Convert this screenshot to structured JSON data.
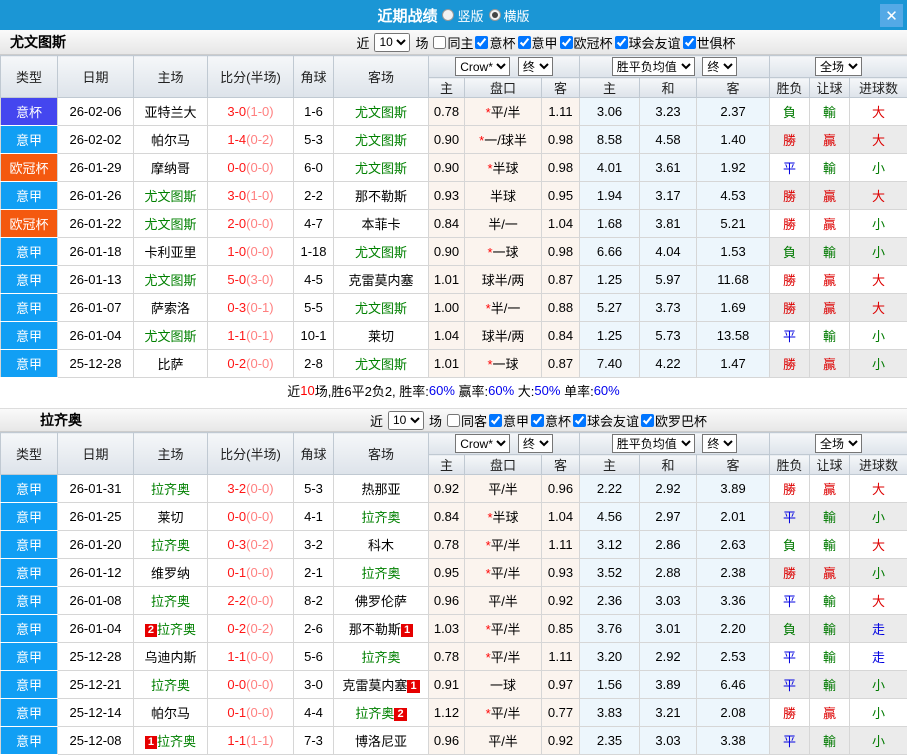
{
  "titlebar": {
    "title": "近期战绩",
    "radios": [
      {
        "label": "竖版",
        "selected": false
      },
      {
        "label": "横版",
        "selected": true
      }
    ],
    "close_label": "✕"
  },
  "league_colors": {
    "意甲": "#119ff4",
    "意杯": "#4446ef",
    "欧冠杯": "#f4590f"
  },
  "table_headers": {
    "type": "类型",
    "date": "日期",
    "home": "主场",
    "score": "比分(半场)",
    "corner": "角球",
    "away": "客场",
    "odds_home": "主",
    "handicap": "盘口",
    "odds_away": "客",
    "avg_home": "主",
    "avg_draw": "和",
    "avg_away": "客",
    "result_wdl": "胜负",
    "result_handicap": "让球",
    "result_goals": "进球数",
    "dd_crow": "Crow*",
    "dd_final1": "终",
    "dd_avg": "胜平负均值",
    "dd_final2": "终",
    "dd_fulltime": "全场"
  },
  "sections": [
    {
      "team": "尤文图斯",
      "filter": {
        "jin": "近",
        "count": "10",
        "chang": "场",
        "checkboxes": [
          {
            "label": "同主",
            "checked": false
          },
          {
            "label": "意杯",
            "checked": true
          },
          {
            "label": "意甲",
            "checked": true
          },
          {
            "label": "欧冠杯",
            "checked": true
          },
          {
            "label": "球会友谊",
            "checked": true
          },
          {
            "label": "世俱杯",
            "checked": true
          }
        ]
      },
      "rows": [
        {
          "lg": "意杯",
          "date": "26-02-06",
          "home": "亚特兰大",
          "hg": false,
          "hb": "",
          "score": "3-0",
          "half": "(1-0)",
          "cn": "1-6",
          "away": "尤文图斯",
          "ag": true,
          "ab": "",
          "o": [
            "0.78",
            "平/半",
            "1.11"
          ],
          "star": true,
          "avg": [
            "3.06",
            "3.23",
            "2.37"
          ],
          "res": [
            [
              "負",
              "g"
            ],
            [
              "輸",
              "g"
            ],
            [
              "大",
              "r"
            ]
          ]
        },
        {
          "lg": "意甲",
          "date": "26-02-02",
          "home": "帕尔马",
          "hg": false,
          "hb": "",
          "score": "1-4",
          "half": "(0-2)",
          "cn": "5-3",
          "away": "尤文图斯",
          "ag": true,
          "ab": "",
          "o": [
            "0.90",
            "一/球半",
            "0.98"
          ],
          "star": true,
          "avg": [
            "8.58",
            "4.58",
            "1.40"
          ],
          "res": [
            [
              "勝",
              "r"
            ],
            [
              "贏",
              "r"
            ],
            [
              "大",
              "r"
            ]
          ]
        },
        {
          "lg": "欧冠杯",
          "date": "26-01-29",
          "home": "摩纳哥",
          "hg": false,
          "hb": "",
          "score": "0-0",
          "half": "(0-0)",
          "cn": "6-0",
          "away": "尤文图斯",
          "ag": true,
          "ab": "",
          "o": [
            "0.90",
            "半球",
            "0.98"
          ],
          "star": true,
          "avg": [
            "4.01",
            "3.61",
            "1.92"
          ],
          "res": [
            [
              "平",
              "b"
            ],
            [
              "輸",
              "g"
            ],
            [
              "小",
              "g"
            ]
          ]
        },
        {
          "lg": "意甲",
          "date": "26-01-26",
          "home": "尤文图斯",
          "hg": true,
          "hb": "",
          "score": "3-0",
          "half": "(1-0)",
          "cn": "2-2",
          "away": "那不勒斯",
          "ag": false,
          "ab": "",
          "o": [
            "0.93",
            "半球",
            "0.95"
          ],
          "star": false,
          "avg": [
            "1.94",
            "3.17",
            "4.53"
          ],
          "res": [
            [
              "勝",
              "r"
            ],
            [
              "贏",
              "r"
            ],
            [
              "大",
              "r"
            ]
          ]
        },
        {
          "lg": "欧冠杯",
          "date": "26-01-22",
          "home": "尤文图斯",
          "hg": true,
          "hb": "",
          "score": "2-0",
          "half": "(0-0)",
          "cn": "4-7",
          "away": "本菲卡",
          "ag": false,
          "ab": "",
          "o": [
            "0.84",
            "半/一",
            "1.04"
          ],
          "star": false,
          "avg": [
            "1.68",
            "3.81",
            "5.21"
          ],
          "res": [
            [
              "勝",
              "r"
            ],
            [
              "贏",
              "r"
            ],
            [
              "小",
              "g"
            ]
          ]
        },
        {
          "lg": "意甲",
          "date": "26-01-18",
          "home": "卡利亚里",
          "hg": false,
          "hb": "",
          "score": "1-0",
          "half": "(0-0)",
          "cn": "1-18",
          "away": "尤文图斯",
          "ag": true,
          "ab": "",
          "o": [
            "0.90",
            "一球",
            "0.98"
          ],
          "star": true,
          "avg": [
            "6.66",
            "4.04",
            "1.53"
          ],
          "res": [
            [
              "負",
              "g"
            ],
            [
              "輸",
              "g"
            ],
            [
              "小",
              "g"
            ]
          ]
        },
        {
          "lg": "意甲",
          "date": "26-01-13",
          "home": "尤文图斯",
          "hg": true,
          "hb": "",
          "score": "5-0",
          "half": "(3-0)",
          "cn": "4-5",
          "away": "克雷莫内塞",
          "ag": false,
          "ab": "",
          "o": [
            "1.01",
            "球半/两",
            "0.87"
          ],
          "star": false,
          "avg": [
            "1.25",
            "5.97",
            "11.68"
          ],
          "res": [
            [
              "勝",
              "r"
            ],
            [
              "贏",
              "r"
            ],
            [
              "大",
              "r"
            ]
          ]
        },
        {
          "lg": "意甲",
          "date": "26-01-07",
          "home": "萨索洛",
          "hg": false,
          "hb": "",
          "score": "0-3",
          "half": "(0-1)",
          "cn": "5-5",
          "away": "尤文图斯",
          "ag": true,
          "ab": "",
          "o": [
            "1.00",
            "半/一",
            "0.88"
          ],
          "star": true,
          "avg": [
            "5.27",
            "3.73",
            "1.69"
          ],
          "res": [
            [
              "勝",
              "r"
            ],
            [
              "贏",
              "r"
            ],
            [
              "大",
              "r"
            ]
          ]
        },
        {
          "lg": "意甲",
          "date": "26-01-04",
          "home": "尤文图斯",
          "hg": true,
          "hb": "",
          "score": "1-1",
          "half": "(0-1)",
          "cn": "10-1",
          "away": "莱切",
          "ag": false,
          "ab": "",
          "o": [
            "1.04",
            "球半/两",
            "0.84"
          ],
          "star": false,
          "avg": [
            "1.25",
            "5.73",
            "13.58"
          ],
          "res": [
            [
              "平",
              "b"
            ],
            [
              "輸",
              "g"
            ],
            [
              "小",
              "g"
            ]
          ]
        },
        {
          "lg": "意甲",
          "date": "25-12-28",
          "home": "比萨",
          "hg": false,
          "hb": "",
          "score": "0-2",
          "half": "(0-0)",
          "cn": "2-8",
          "away": "尤文图斯",
          "ag": true,
          "ab": "",
          "o": [
            "1.01",
            "一球",
            "0.87"
          ],
          "star": true,
          "avg": [
            "7.40",
            "4.22",
            "1.47"
          ],
          "res": [
            [
              "勝",
              "r"
            ],
            [
              "贏",
              "r"
            ],
            [
              "小",
              "g"
            ]
          ]
        }
      ],
      "summary_parts": [
        [
          "近",
          "k"
        ],
        [
          "10",
          "r"
        ],
        [
          "场,胜6平2负2, 胜率:",
          "k"
        ],
        [
          "60%",
          "b"
        ],
        [
          " 赢率:",
          "k"
        ],
        [
          "60%",
          "b"
        ],
        [
          " 大:",
          "k"
        ],
        [
          "50%",
          "b"
        ],
        [
          " 单率:",
          "k"
        ],
        [
          "60%",
          "b"
        ]
      ]
    },
    {
      "team": "拉齐奥",
      "filter": {
        "jin": "近",
        "count": "10",
        "chang": "场",
        "checkboxes": [
          {
            "label": "同客",
            "checked": false
          },
          {
            "label": "意甲",
            "checked": true
          },
          {
            "label": "意杯",
            "checked": true
          },
          {
            "label": "球会友谊",
            "checked": true
          },
          {
            "label": "欧罗巴杯",
            "checked": true
          }
        ]
      },
      "rows": [
        {
          "lg": "意甲",
          "date": "26-01-31",
          "home": "拉齐奥",
          "hg": true,
          "hb": "",
          "score": "3-2",
          "half": "(0-0)",
          "cn": "5-3",
          "away": "热那亚",
          "ag": false,
          "ab": "",
          "o": [
            "0.92",
            "平/半",
            "0.96"
          ],
          "star": false,
          "avg": [
            "2.22",
            "2.92",
            "3.89"
          ],
          "res": [
            [
              "勝",
              "r"
            ],
            [
              "贏",
              "r"
            ],
            [
              "大",
              "r"
            ]
          ]
        },
        {
          "lg": "意甲",
          "date": "26-01-25",
          "home": "莱切",
          "hg": false,
          "hb": "",
          "score": "0-0",
          "half": "(0-0)",
          "cn": "4-1",
          "away": "拉齐奥",
          "ag": true,
          "ab": "",
          "o": [
            "0.84",
            "半球",
            "1.04"
          ],
          "star": true,
          "avg": [
            "4.56",
            "2.97",
            "2.01"
          ],
          "res": [
            [
              "平",
              "b"
            ],
            [
              "輸",
              "g"
            ],
            [
              "小",
              "g"
            ]
          ]
        },
        {
          "lg": "意甲",
          "date": "26-01-20",
          "home": "拉齐奥",
          "hg": true,
          "hb": "",
          "score": "0-3",
          "half": "(0-2)",
          "cn": "3-2",
          "away": "科木",
          "ag": false,
          "ab": "",
          "o": [
            "0.78",
            "平/半",
            "1.11"
          ],
          "star": true,
          "avg": [
            "3.12",
            "2.86",
            "2.63"
          ],
          "res": [
            [
              "負",
              "g"
            ],
            [
              "輸",
              "g"
            ],
            [
              "大",
              "r"
            ]
          ]
        },
        {
          "lg": "意甲",
          "date": "26-01-12",
          "home": "维罗纳",
          "hg": false,
          "hb": "",
          "score": "0-1",
          "half": "(0-0)",
          "cn": "2-1",
          "away": "拉齐奥",
          "ag": true,
          "ab": "",
          "o": [
            "0.95",
            "平/半",
            "0.93"
          ],
          "star": true,
          "avg": [
            "3.52",
            "2.88",
            "2.38"
          ],
          "res": [
            [
              "勝",
              "r"
            ],
            [
              "贏",
              "r"
            ],
            [
              "小",
              "g"
            ]
          ]
        },
        {
          "lg": "意甲",
          "date": "26-01-08",
          "home": "拉齐奥",
          "hg": true,
          "hb": "",
          "score": "2-2",
          "half": "(0-0)",
          "cn": "8-2",
          "away": "佛罗伦萨",
          "ag": false,
          "ab": "",
          "o": [
            "0.96",
            "平/半",
            "0.92"
          ],
          "star": false,
          "avg": [
            "2.36",
            "3.03",
            "3.36"
          ],
          "res": [
            [
              "平",
              "b"
            ],
            [
              "輸",
              "g"
            ],
            [
              "大",
              "r"
            ]
          ]
        },
        {
          "lg": "意甲",
          "date": "26-01-04",
          "home": "拉齐奥",
          "hg": true,
          "hb": "2",
          "score": "0-2",
          "half": "(0-2)",
          "cn": "2-6",
          "away": "那不勒斯",
          "ag": false,
          "ab": "1",
          "o": [
            "1.03",
            "平/半",
            "0.85"
          ],
          "star": true,
          "avg": [
            "3.76",
            "3.01",
            "2.20"
          ],
          "res": [
            [
              "負",
              "g"
            ],
            [
              "輸",
              "g"
            ],
            [
              "走",
              "b"
            ]
          ]
        },
        {
          "lg": "意甲",
          "date": "25-12-28",
          "home": "乌迪内斯",
          "hg": false,
          "hb": "",
          "score": "1-1",
          "half": "(0-0)",
          "cn": "5-6",
          "away": "拉齐奥",
          "ag": true,
          "ab": "",
          "o": [
            "0.78",
            "平/半",
            "1.11"
          ],
          "star": true,
          "avg": [
            "3.20",
            "2.92",
            "2.53"
          ],
          "res": [
            [
              "平",
              "b"
            ],
            [
              "輸",
              "g"
            ],
            [
              "走",
              "b"
            ]
          ]
        },
        {
          "lg": "意甲",
          "date": "25-12-21",
          "home": "拉齐奥",
          "hg": true,
          "hb": "",
          "score": "0-0",
          "half": "(0-0)",
          "cn": "3-0",
          "away": "克雷莫内塞",
          "ag": false,
          "ab": "1",
          "o": [
            "0.91",
            "一球",
            "0.97"
          ],
          "star": false,
          "avg": [
            "1.56",
            "3.89",
            "6.46"
          ],
          "res": [
            [
              "平",
              "b"
            ],
            [
              "輸",
              "g"
            ],
            [
              "小",
              "g"
            ]
          ]
        },
        {
          "lg": "意甲",
          "date": "25-12-14",
          "home": "帕尔马",
          "hg": false,
          "hb": "",
          "score": "0-1",
          "half": "(0-0)",
          "cn": "4-4",
          "away": "拉齐奥",
          "ag": true,
          "ab": "2",
          "o": [
            "1.12",
            "平/半",
            "0.77"
          ],
          "star": true,
          "avg": [
            "3.83",
            "3.21",
            "2.08"
          ],
          "res": [
            [
              "勝",
              "r"
            ],
            [
              "贏",
              "r"
            ],
            [
              "小",
              "g"
            ]
          ]
        },
        {
          "lg": "意甲",
          "date": "25-12-08",
          "home": "拉齐奥",
          "hg": true,
          "hb": "1",
          "score": "1-1",
          "half": "(1-1)",
          "cn": "7-3",
          "away": "博洛尼亚",
          "ag": false,
          "ab": "",
          "o": [
            "0.96",
            "平/半",
            "0.92"
          ],
          "star": false,
          "avg": [
            "2.35",
            "3.03",
            "3.38"
          ],
          "res": [
            [
              "平",
              "b"
            ],
            [
              "輸",
              "g"
            ],
            [
              "小",
              "g"
            ]
          ]
        }
      ],
      "summary_parts": []
    }
  ]
}
